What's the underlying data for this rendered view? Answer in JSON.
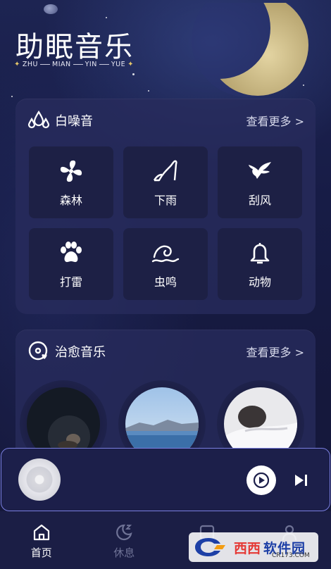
{
  "header": {
    "title": "助眠音乐",
    "subtitle": [
      "ZHU",
      "MIAN",
      "YIN",
      "YUE"
    ]
  },
  "white_noise": {
    "title": "白噪音",
    "more": "查看更多 >",
    "items": [
      {
        "label": "森林",
        "icon": "fan-icon"
      },
      {
        "label": "下雨",
        "icon": "high-heel-icon"
      },
      {
        "label": "刮风",
        "icon": "bird-icon"
      },
      {
        "label": "打雷",
        "icon": "paw-icon"
      },
      {
        "label": "虫鸣",
        "icon": "wave-icon"
      },
      {
        "label": "动物",
        "icon": "bell-icon"
      }
    ]
  },
  "healing_music": {
    "title": "治愈音乐",
    "more": "查看更多 >"
  },
  "tabs": [
    {
      "label": "首页",
      "icon": "home-icon",
      "active": true
    },
    {
      "label": "休息",
      "icon": "moon-sleep-icon",
      "active": false
    }
  ],
  "watermark": {
    "brand": "西西",
    "text": "软件园",
    "url": "CR173.COM"
  },
  "colors": {
    "background": "#15183c",
    "card": "#282c5c",
    "tile": "#1d2045",
    "player_border": "#7a7fe0",
    "moon": "#c9b98a"
  }
}
